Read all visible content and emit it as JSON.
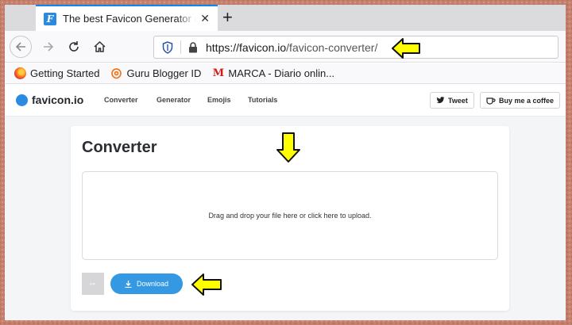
{
  "browser": {
    "tab": {
      "title": "The best Favicon Generator (co",
      "favicon_letter": "F",
      "close_glyph": "✕"
    },
    "new_tab_glyph": "+",
    "url": {
      "host": "https://favicon.io",
      "path": "/favicon-converter/"
    },
    "bookmarks": [
      {
        "label": "Getting Started"
      },
      {
        "label": "Guru Blogger ID"
      },
      {
        "label": "MARCA - Diario onlin...",
        "icon_letter": "M"
      }
    ]
  },
  "site": {
    "logo": "favicon.io",
    "nav": [
      "Converter",
      "Generator",
      "Emojis",
      "Tutorials"
    ],
    "tweet_label": "Tweet",
    "coffee_label": "Buy me a coffee"
  },
  "converter": {
    "title": "Converter",
    "dropzone_text": "Drag and drop your file here or click here to upload.",
    "download_label": "Download",
    "disabled_button_glyph": "▸▸"
  },
  "colors": {
    "accent": "#3598e3",
    "annotation_arrow": "#ffff00",
    "tab_highlight": "#0a84ff"
  },
  "icons": [
    "favicon-io-icon",
    "close-icon",
    "plus-icon",
    "back-icon",
    "forward-icon",
    "reload-icon",
    "home-icon",
    "shield-icon",
    "lock-icon",
    "firefox-icon",
    "blogger-icon",
    "marca-icon",
    "twitter-icon",
    "coffee-icon",
    "download-icon",
    "annotation-arrow-icon"
  ]
}
